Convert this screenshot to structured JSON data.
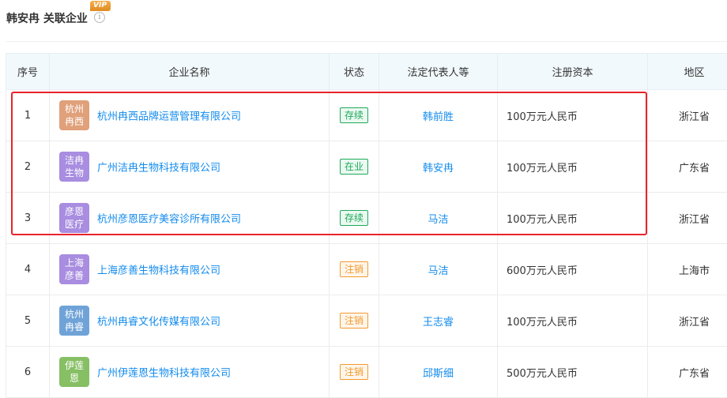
{
  "header": {
    "title": "韩安冉 关联企业",
    "vip_badge": "VIP",
    "info_icon": "info-circle-icon"
  },
  "table": {
    "columns": [
      "序号",
      "企业名称",
      "状态",
      "法定代表人等",
      "注册资本",
      "地区"
    ],
    "rows": [
      {
        "index": "1",
        "logo_line1": "杭州",
        "logo_line2": "冉西",
        "logo_color": "#e0a07a",
        "company": "杭州冉西品牌运营管理有限公司",
        "status": "存续",
        "status_color": "#1fa95a",
        "rep": "韩前胜",
        "capital": "100万元人民币",
        "region": "浙江省"
      },
      {
        "index": "2",
        "logo_line1": "洁冉",
        "logo_line2": "生物",
        "logo_color": "#a88de0",
        "company": "广州洁冉生物科技有限公司",
        "status": "在业",
        "status_color": "#1fa95a",
        "rep": "韩安冉",
        "capital": "100万元人民币",
        "region": "广东省"
      },
      {
        "index": "3",
        "logo_line1": "彦恩",
        "logo_line2": "医疗",
        "logo_color": "#a88de0",
        "company": "杭州彦恩医疗美容诊所有限公司",
        "status": "存续",
        "status_color": "#1fa95a",
        "rep": "马洁",
        "capital": "100万元人民币",
        "region": "浙江省"
      },
      {
        "index": "4",
        "logo_line1": "上海",
        "logo_line2": "彦善",
        "logo_color": "#a88de0",
        "company": "上海彦善生物科技有限公司",
        "status": "注销",
        "status_color": "#f29a2e",
        "rep": "马洁",
        "capital": "600万元人民币",
        "region": "上海市"
      },
      {
        "index": "5",
        "logo_line1": "杭州",
        "logo_line2": "冉睿",
        "logo_color": "#6fa3d8",
        "company": "杭州冉睿文化传媒有限公司",
        "status": "注销",
        "status_color": "#f29a2e",
        "rep": "王志睿",
        "capital": "100万元人民币",
        "region": "浙江省"
      },
      {
        "index": "6",
        "logo_line1": "伊莲",
        "logo_line2": "恩",
        "logo_color": "#86bf64",
        "company": "广州伊莲恩生物科技有限公司",
        "status": "注销",
        "status_color": "#f29a2e",
        "rep": "邱斯细",
        "capital": "500万元人民币",
        "region": "广东省"
      }
    ]
  },
  "colors": {
    "link": "#128bed",
    "header_bg": "#f2f9fc",
    "highlight_border": "#e8232b"
  }
}
